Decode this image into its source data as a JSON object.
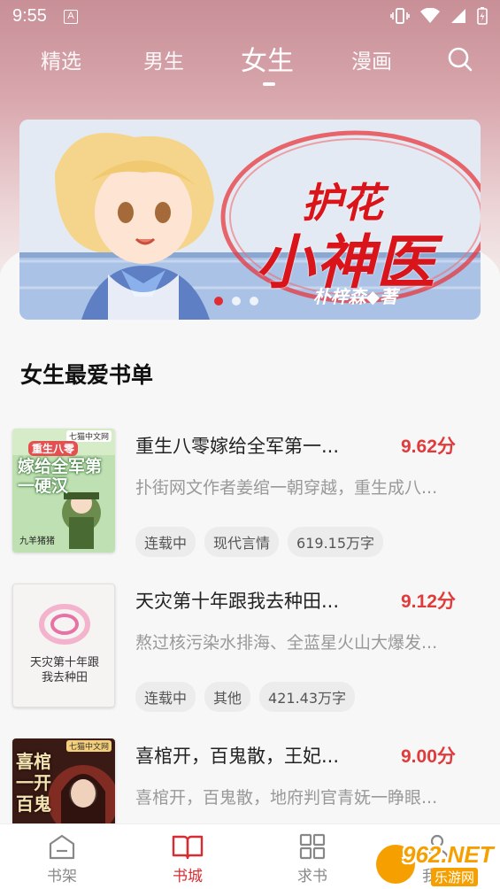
{
  "status_bar": {
    "time": "9:55",
    "notif_letter": "A"
  },
  "tabs": [
    {
      "label": "精选"
    },
    {
      "label": "男生"
    },
    {
      "label": "女生",
      "active": true
    },
    {
      "label": "漫画"
    }
  ],
  "banner": {
    "title_line1": "护花",
    "title_line2": "小神医",
    "author": "朴梓森◆著",
    "slide_count": 3,
    "active_slide": 1
  },
  "section": {
    "title": "女生最爱书单"
  },
  "books": [
    {
      "title": "重生八零嫁给全军第一...",
      "score": "9.62分",
      "desc": "扑街网文作者姜绾一朝穿越，重生成八...",
      "tags": [
        "连载中",
        "现代言情",
        "619.15万字"
      ],
      "cover": {
        "badge": "七猫中文网",
        "big_text": "嫁给全军第一硬汉",
        "small_text": "重生八零",
        "author": "九羊猪猪",
        "bg": "#bfe0b2"
      }
    },
    {
      "title": "天灾第十年跟我去种田...",
      "score": "9.12分",
      "desc": "熬过核污染水排海、全蓝星火山大爆发...",
      "tags": [
        "连载中",
        "其他",
        "421.43万字"
      ],
      "cover": {
        "big_text": "天灾第十年跟我去种田",
        "bg": "#f6f3f3"
      }
    },
    {
      "title": "喜棺开，百鬼散，王妃...",
      "score": "9.00分",
      "desc": "喜棺开，百鬼散，地府判官青妩一睁眼...",
      "tags": [],
      "cover": {
        "badge": "七猫中文网",
        "big_text": "喜棺一开百鬼",
        "bg": "#3a1a14"
      }
    }
  ],
  "bottom_nav": [
    {
      "label": "书架",
      "icon": "bookshelf-icon"
    },
    {
      "label": "书城",
      "icon": "book-open-icon",
      "active": true
    },
    {
      "label": "求书",
      "icon": "grid-icon"
    },
    {
      "label": "我的",
      "icon": "user-icon"
    }
  ],
  "watermark": {
    "text": "962.NET",
    "subtext": "乐游网"
  },
  "colors": {
    "accent": "#e03a3a",
    "nav_active": "#d82c33",
    "tag_bg": "#ececec"
  }
}
